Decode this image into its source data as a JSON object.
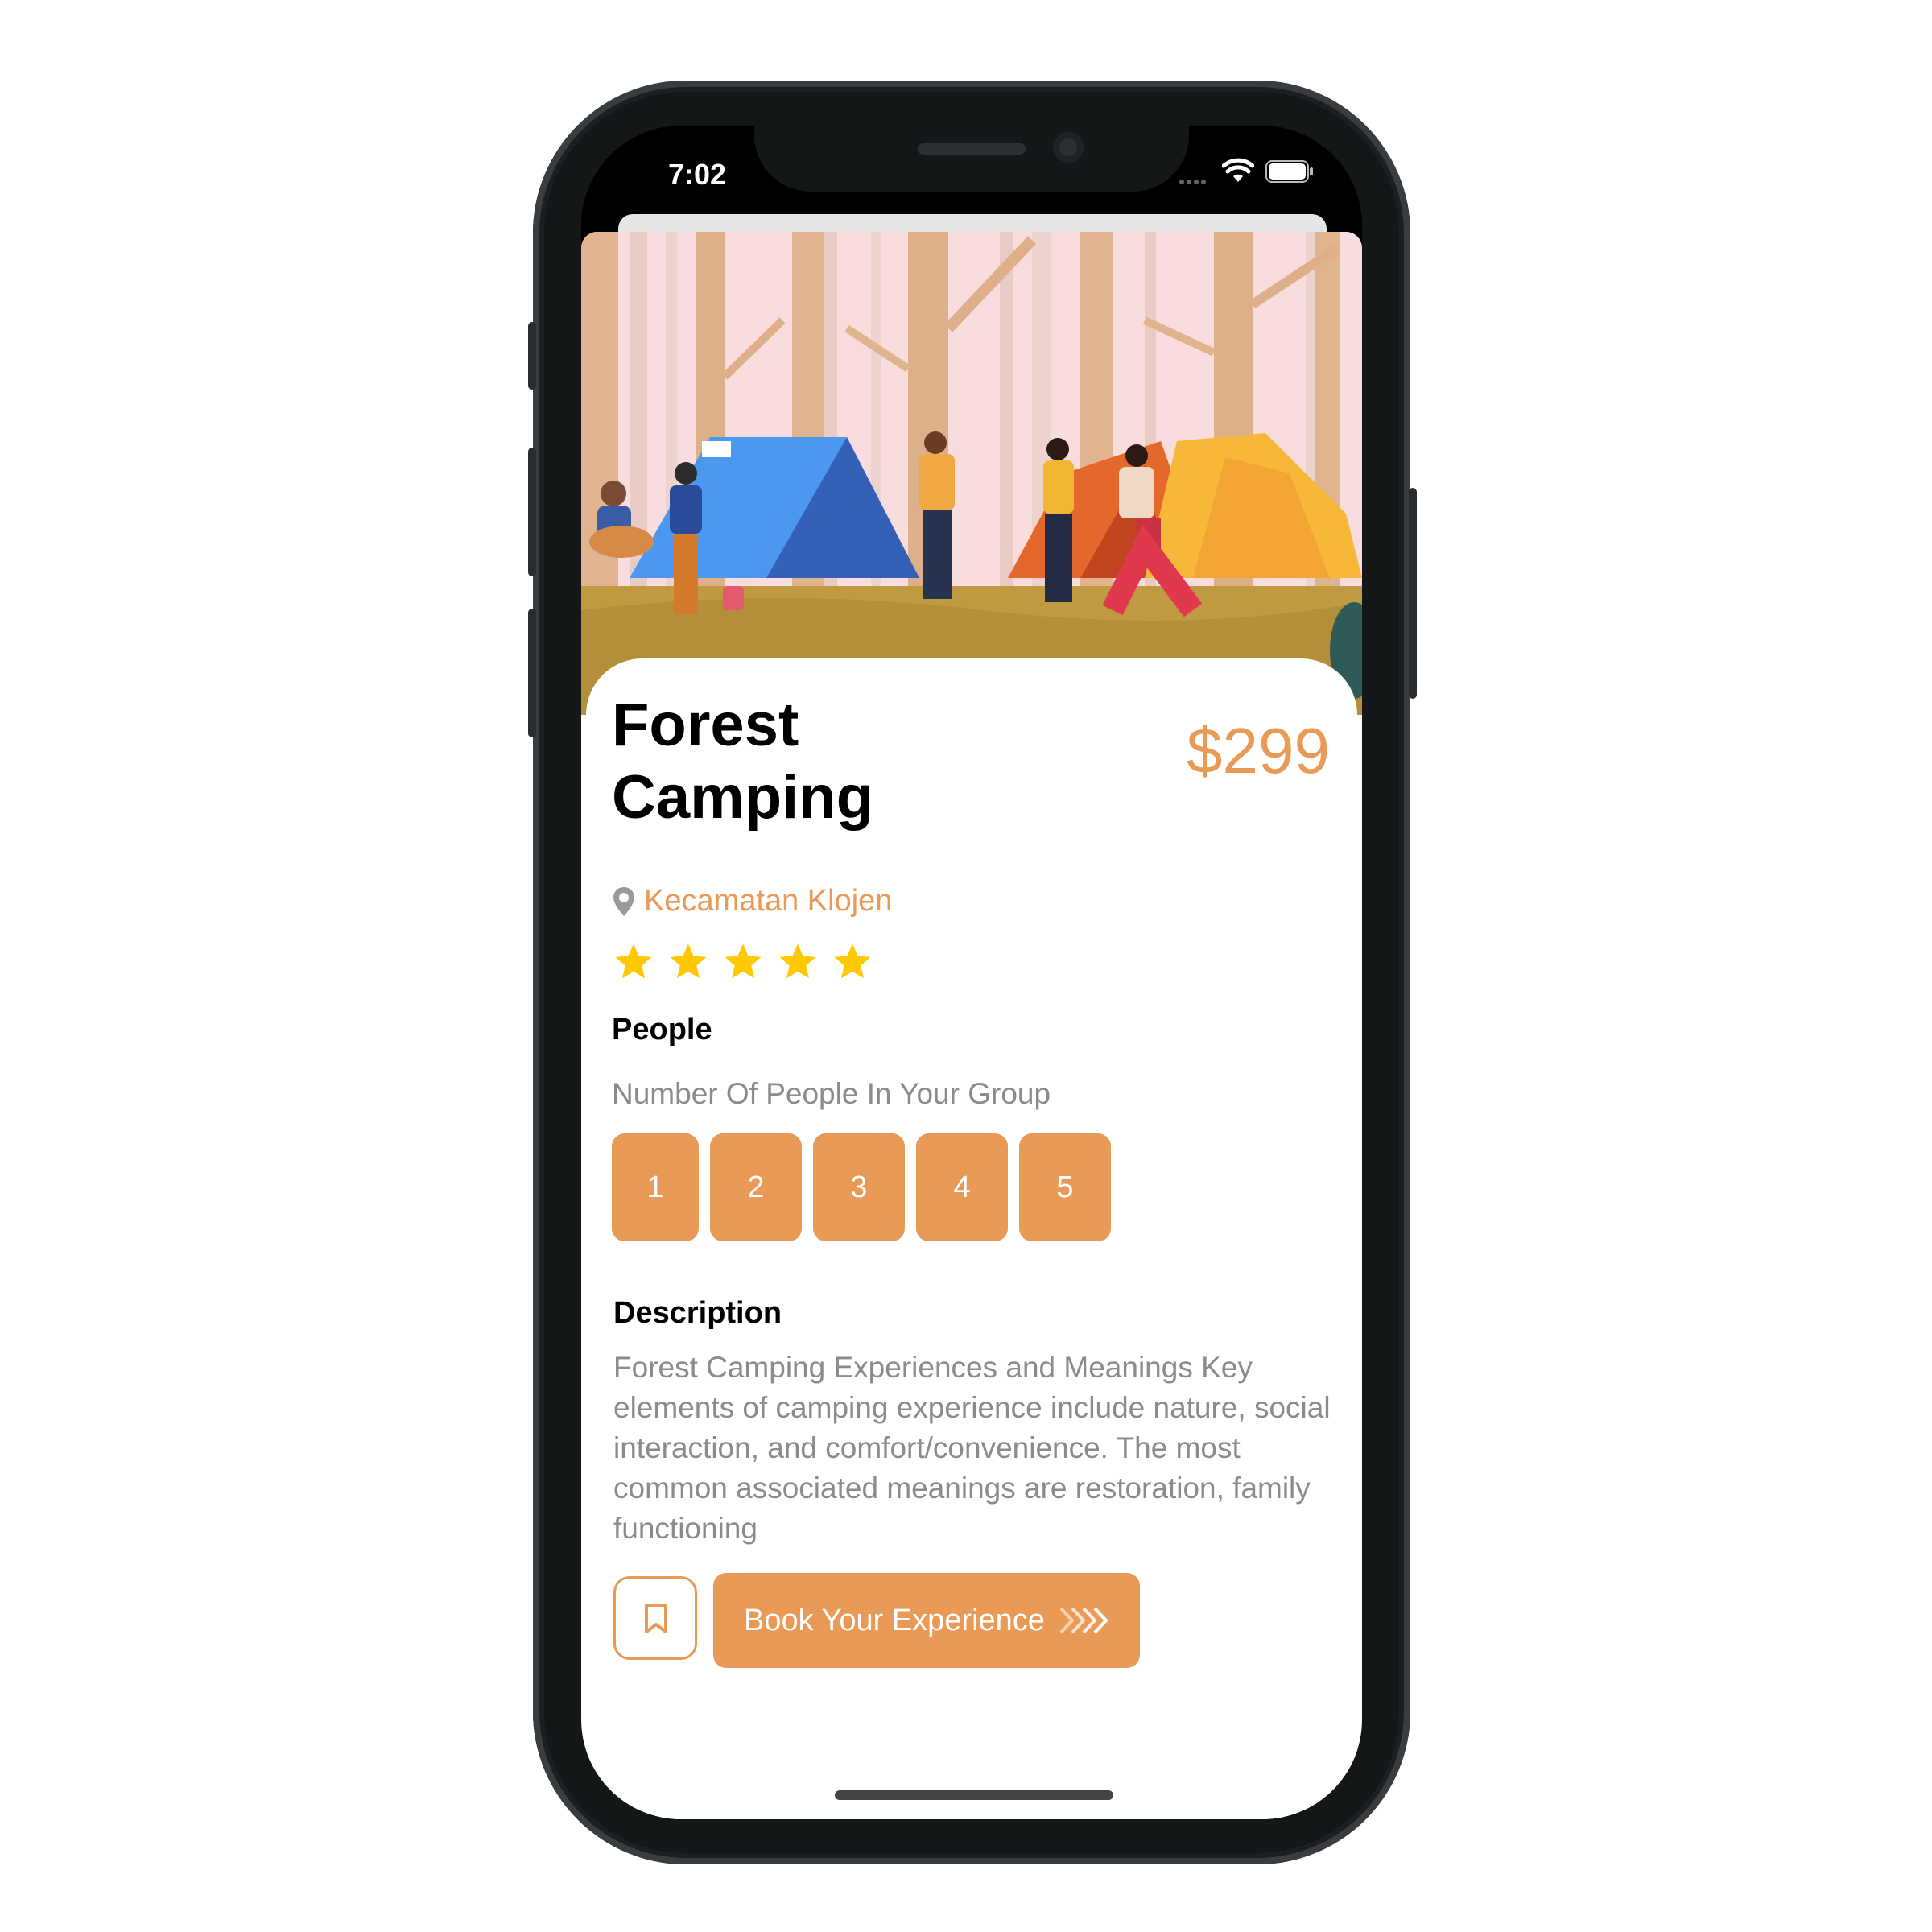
{
  "status_bar": {
    "time": "7:02"
  },
  "product": {
    "title_line1": "Forest",
    "title_line2": "Camping",
    "price": "$299",
    "location": "Kecamatan Klojen",
    "rating": 5,
    "rating_max": 5
  },
  "people": {
    "heading": "People",
    "subtitle": "Number Of People In Your Group",
    "options": [
      "1",
      "2",
      "3",
      "4",
      "5"
    ]
  },
  "description": {
    "heading": "Description",
    "text": "Forest Camping Experiences and Meanings Key elements of camping experience include nature, social interaction, and comfort/convenience. The most common associated meanings are restoration, family functioning"
  },
  "actions": {
    "book_label": "Book Your Experience"
  },
  "colors": {
    "accent": "#E89A56",
    "star": "#FFC800",
    "muted_text": "#8a8a8f"
  },
  "icons": [
    "location-pin-icon",
    "star-icon",
    "bookmark-icon",
    "chevrons-right-icon",
    "wifi-icon",
    "battery-icon",
    "cellular-icon"
  ]
}
